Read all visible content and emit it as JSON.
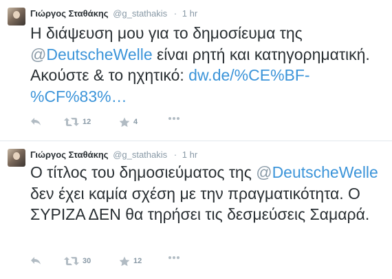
{
  "tweets": [
    {
      "fullname": "Γιώργος Σταθάκης",
      "username": "@g_stathakis",
      "separator": "·",
      "time": "1 hr",
      "text_part1": "Η διάψευση μου για το δημοσίευμα της ",
      "mention_at": "@",
      "mention_name": "DeutscheWelle",
      "text_part2": " είναι ρητή και κατηγορηματική. Ακούστε & το ηχητικό: ",
      "link": "dw.de/%CE%BF-%CF%83%…",
      "retweets": "12",
      "favorites": "4"
    },
    {
      "fullname": "Γιώργος Σταθάκης",
      "username": "@g_stathakis",
      "separator": "·",
      "time": "1 hr",
      "text_part1": "Ο τίτλος του δημοσιεύματος της ",
      "mention_at": "@",
      "mention_name": "DeutscheWelle",
      "text_part2": " δεν έχει καμία σχέση με την πραγματικότητα. Ο ΣΥΡΙΖΑ ΔΕΝ θα τηρήσει τις δεσμεύσεις Σαμαρά.",
      "retweets": "30",
      "favorites": "12"
    }
  ],
  "icons": {
    "reply": "reply-icon",
    "retweet": "retweet-icon",
    "favorite": "star-icon",
    "more": "more-icon"
  },
  "colors": {
    "link": "#3b94d9",
    "meta": "#8899a6",
    "text": "#292f33"
  }
}
